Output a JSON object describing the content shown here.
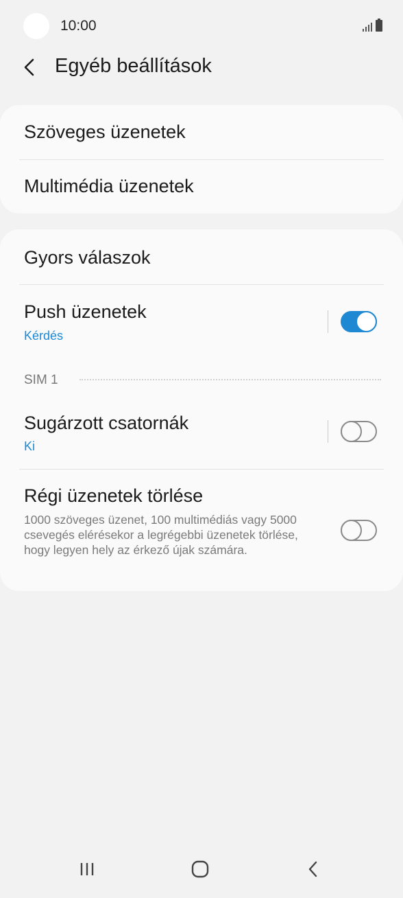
{
  "status_bar": {
    "time": "10:00"
  },
  "header": {
    "title": "Egyéb beállítások"
  },
  "card1": {
    "items": [
      {
        "label": "Szöveges üzenetek"
      },
      {
        "label": "Multimédia üzenetek"
      }
    ]
  },
  "card2": {
    "quick_replies": {
      "label": "Gyors válaszok"
    },
    "push": {
      "label": "Push üzenetek",
      "sub": "Kérdés",
      "enabled": true
    },
    "section": {
      "label": "SIM 1"
    },
    "broadcast": {
      "label": "Sugárzott csatornák",
      "sub": "Ki",
      "enabled": false
    },
    "delete_old": {
      "label": "Régi üzenetek törlése",
      "description": "1000 szöveges üzenet, 100 multimédiás vagy 5000 csevegés elérésekor a legrégebbi üzenetek törlése, hogy legyen hely az érkező újak számára.",
      "enabled": false
    }
  },
  "colors": {
    "accent": "#1e88d2",
    "background": "#f2f2f2",
    "card": "#fafafa"
  },
  "icons": {
    "back": "chevron-left-icon",
    "nav_recents": "recents-icon",
    "nav_home": "home-icon",
    "nav_back": "back-icon"
  }
}
